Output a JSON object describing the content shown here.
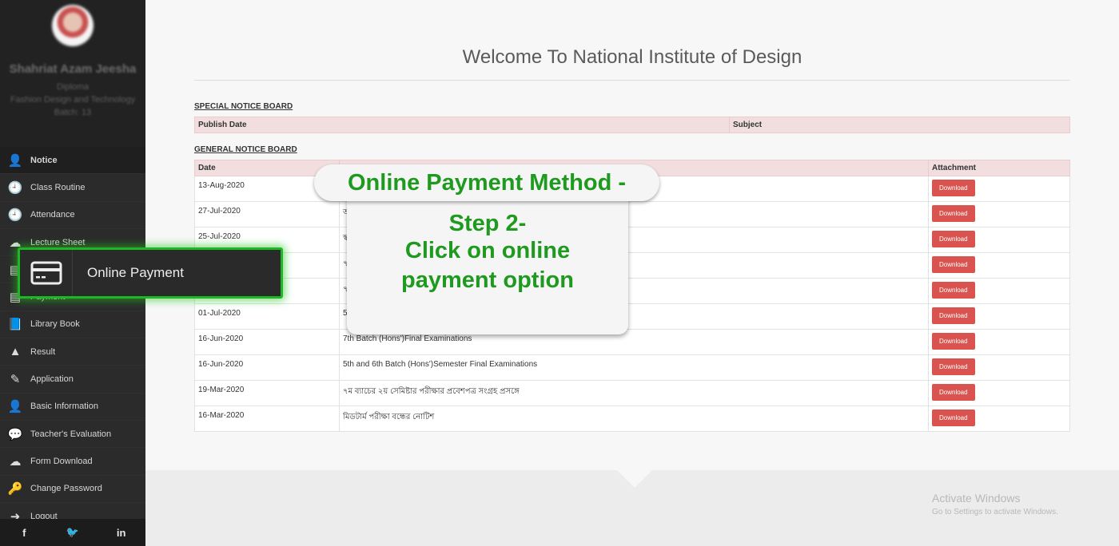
{
  "profile": {
    "name": "Shahriat Azam Jeesha",
    "program": "Diploma",
    "department": "Fashion Design and Technology",
    "batch": "Batch: 13"
  },
  "sidebar": {
    "items": [
      {
        "label": "Notice",
        "icon": "user-icon",
        "active": true
      },
      {
        "label": "Class Routine",
        "icon": "clock-icon"
      },
      {
        "label": "Attendance",
        "icon": "clock-icon"
      },
      {
        "label": "Lecture Sheet",
        "icon": "cloud-download-icon"
      },
      {
        "label": "Online Payment",
        "icon": "credit-card-icon"
      },
      {
        "label": "Payment",
        "icon": "credit-card-icon"
      },
      {
        "label": "Library Book",
        "icon": "book-icon"
      },
      {
        "label": "Result",
        "icon": "road-icon"
      },
      {
        "label": "Application",
        "icon": "edit-icon"
      },
      {
        "label": "Basic Information",
        "icon": "user-icon"
      },
      {
        "label": "Teacher's Evaluation",
        "icon": "comments-icon"
      },
      {
        "label": "Form Download",
        "icon": "cloud-download-icon"
      },
      {
        "label": "Change Password",
        "icon": "key-icon"
      },
      {
        "label": "Logout",
        "icon": "sign-out-icon"
      }
    ],
    "social": [
      "f",
      "t",
      "in"
    ]
  },
  "main": {
    "title": "Welcome To National Institute of Design",
    "special_notice": {
      "heading": "SPECIAL NOTICE BOARD",
      "columns": [
        "Publish Date",
        "Subject"
      ]
    },
    "general_notice": {
      "heading": "GENERAL NOTICE BOARD",
      "columns": [
        "Date",
        "",
        "Attachment"
      ],
      "download_label": "Download",
      "rows": [
        {
          "date": "13-Aug-2020",
          "subject": ""
        },
        {
          "date": "27-Jul-2020",
          "subject": "অ"
        },
        {
          "date": "25-Jul-2020",
          "subject": "স্ব"
        },
        {
          "date": "",
          "subject": "৭"
        },
        {
          "date": "",
          "subject": "৭"
        },
        {
          "date": "01-Jul-2020",
          "subject": "5"
        },
        {
          "date": "16-Jun-2020",
          "subject": "7th Batch (Hons')Final Examinations"
        },
        {
          "date": "16-Jun-2020",
          "subject": "5th and 6th Batch (Hons')Semester Final Examinations"
        },
        {
          "date": "19-Mar-2020",
          "subject": "৭ম ব্যাচের ২য় সেমিষ্টার পরীক্ষার প্রবেশপত্র সংগ্রহ প্রসঙ্গে"
        },
        {
          "date": "16-Mar-2020",
          "subject": "মিডটার্ম পরীক্ষা বন্ধের নোটিশ"
        }
      ]
    }
  },
  "overlay": {
    "method_title": "Online Payment Method -",
    "step_title": "Step 2-",
    "step_text_line1": "Click on online",
    "step_text_line2": "payment option",
    "callout_label": "Online Payment",
    "callout_icon": "credit-card-icon",
    "accent_color": "#1e9a1e"
  },
  "watermark": {
    "line1": "Activate Windows",
    "line2": "Go to Settings to activate Windows."
  }
}
